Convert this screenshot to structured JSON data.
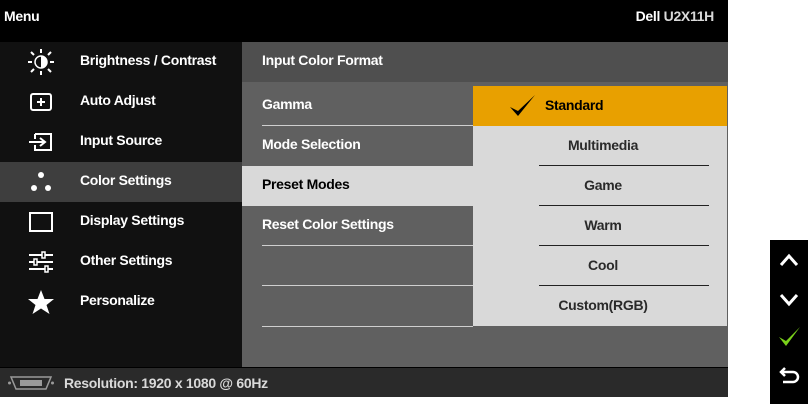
{
  "header": {
    "menu_label": "Menu",
    "brand": "Dell",
    "model": "U2X11H"
  },
  "sidebar": {
    "items": [
      {
        "label": "Brightness / Contrast",
        "icon": "brightness-icon"
      },
      {
        "label": "Auto Adjust",
        "icon": "auto-adjust-icon"
      },
      {
        "label": "Input Source",
        "icon": "input-source-icon"
      },
      {
        "label": "Color Settings",
        "icon": "color-settings-icon",
        "active": true
      },
      {
        "label": "Display Settings",
        "icon": "display-settings-icon"
      },
      {
        "label": "Other Settings",
        "icon": "other-settings-icon"
      },
      {
        "label": "Personalize",
        "icon": "star-icon"
      }
    ]
  },
  "submenu": {
    "items": [
      {
        "label": "Input Color Format"
      },
      {
        "label": "Gamma"
      },
      {
        "label": "Mode Selection"
      },
      {
        "label": "Preset Modes",
        "active": true
      },
      {
        "label": "Reset Color Settings"
      }
    ]
  },
  "preset_options": {
    "selected": "Standard",
    "items": [
      "Standard",
      "Multimedia",
      "Game",
      "Warm",
      "Cool",
      "Custom(RGB)"
    ]
  },
  "status": {
    "resolution_text": "Resolution: 1920 x 1080 @ 60Hz",
    "icon": "vga-connector-icon"
  },
  "nav_buttons": [
    "up-arrow-icon",
    "down-arrow-icon",
    "check-icon",
    "back-icon"
  ],
  "colors": {
    "highlight": "#e8a000",
    "panel": "#606060",
    "active_row": "#d9d9d9",
    "check_green": "#7ad11a"
  }
}
